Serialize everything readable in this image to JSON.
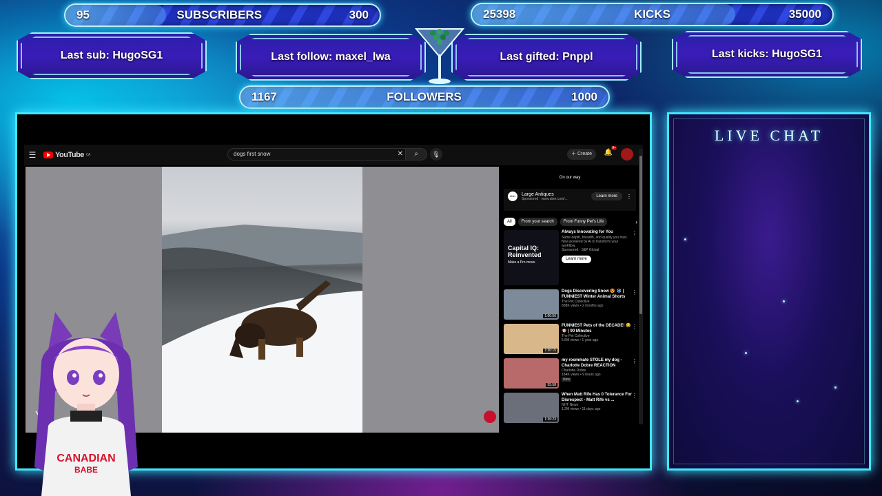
{
  "stats": {
    "subscribers": {
      "current": "95",
      "label": "SUBSCRIBERS",
      "goal": "300",
      "progress": 0.317
    },
    "kicks": {
      "current": "25398",
      "label": "KICKS",
      "goal": "35000",
      "progress": 0.726
    },
    "followers": {
      "current": "1167",
      "label": "FOLLOWERS",
      "goal": "1000",
      "progress": 1.0
    }
  },
  "last_events": {
    "sub": "Last sub: HugoSG1",
    "follow": "Last follow: maxel_lwa",
    "gifted": "Last gifted: Pnppl",
    "kicks": "Last kicks: HugoSG1"
  },
  "chat": {
    "title": "LIVE CHAT"
  },
  "youtube": {
    "logo": "YouTube",
    "region": "CA",
    "search_value": "dogs first snow",
    "create_label": "Create",
    "notif_count": "9+",
    "video_overlay_text": "YO",
    "ad": {
      "banner_text": "On our way",
      "logo_text": "Uber",
      "title": "Large Antiques",
      "meta": "Sponsored · www.uber.com/...",
      "cta": "Learn more"
    },
    "chips": [
      "All",
      "From your search",
      "From Funny Pet's Life"
    ],
    "sponsored": {
      "thumb_title": "Capital IQ: Reinvented",
      "thumb_sub": "Make a Pro move.",
      "title": "Always Innovating for You",
      "desc": "Same depth, breadth, and quality you trust. Now powered by AI to transform your workflow.",
      "meta": "Sponsored · S&P Global",
      "cta": "Learn more"
    },
    "recommendations": [
      {
        "title": "Dogs Discovering Snow 😍 ❄️ | FUNNIEST Winter Animal Shorts",
        "channel": "The Pet Collective",
        "meta": "838K views • 2 months ago",
        "duration": "1:00:56",
        "thumb": "#7d8a99"
      },
      {
        "title": "FUNNIEST Pets of the DECADE! 😂 🐶 | 90 Minutes",
        "channel": "The Pet Collective",
        "meta": "5.5M views • 1 year ago",
        "duration": "1:30:15",
        "thumb": "#d8b88a"
      },
      {
        "title": "my roommate STOLE my dog - Charlotte Dobre REACTION",
        "channel": "Charlotte Dobre",
        "meta": "184K views • 9 hours ago",
        "duration": "55:58",
        "badge": "New",
        "thumb": "#b86a6a"
      },
      {
        "title": "When Matt Rife Has 0 Tolerance For Disrespect - Matt Rife vs ...",
        "channel": "NHT News",
        "meta": "1.2M views • 11 days ago",
        "duration": "1:36:23",
        "thumb": "#6b6f7a"
      }
    ]
  },
  "vtuber": {
    "shirt_line1": "CANADIAN",
    "shirt_line2": "BABE"
  },
  "colors": {
    "frame": "#3fe8ff",
    "bar": "#2f47e0",
    "panel": "#2a1fa8",
    "yt_red": "#ff0000"
  }
}
